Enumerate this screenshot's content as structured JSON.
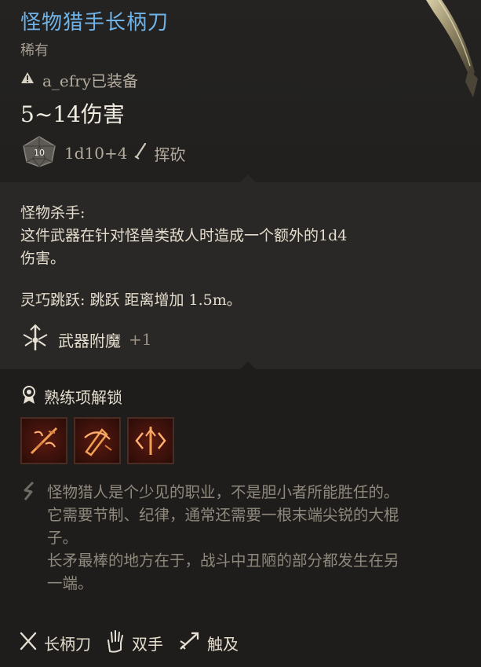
{
  "item": {
    "name": "怪物猎手长柄刀",
    "rarity": "稀有",
    "equipped_by": "a_efry已装备",
    "damage": "5~14伤害",
    "dice": "1d10+4",
    "damage_type": "挥砍",
    "dice_face": "10"
  },
  "passives": {
    "monster_slayer_title": "怪物杀手:",
    "monster_slayer_line1": "这件武器在针对怪兽类敌人时造成一个额外的1d4",
    "monster_slayer_line2": "伤害。",
    "jump": "灵巧跳跃: 跳跃 距离增加 1.5m。"
  },
  "enchant": {
    "label": "武器附魔",
    "value": "+1"
  },
  "proficiency": {
    "label": "熟练项解锁",
    "actions": [
      "action-icon-1",
      "action-icon-2",
      "action-icon-3"
    ]
  },
  "flavor": {
    "line1": "怪物猎人是个少见的职业，不是胆小者所能胜任的。",
    "line2": "它需要节制、纪律，通常还需要一根末端尖锐的大棍",
    "line3": "子。",
    "line4": "长矛最棒的地方在于，战斗中丑陋的部分都发生在另",
    "line5": "一端。"
  },
  "tags": [
    {
      "label": "长柄刀",
      "icon": "polearm-icon"
    },
    {
      "label": "双手",
      "icon": "two-handed-icon"
    },
    {
      "label": "触及",
      "icon": "reach-icon"
    }
  ],
  "colors": {
    "title": "#6fb3e8",
    "flavor": "#8f887c",
    "body": "#e4dccd"
  }
}
